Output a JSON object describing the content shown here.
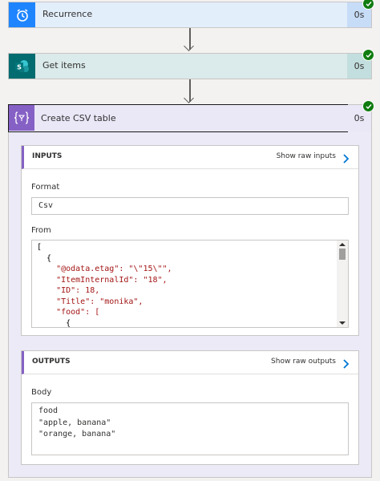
{
  "steps": {
    "recurrence": {
      "title": "Recurrence",
      "duration": "0s",
      "color": "#e3eefb",
      "icon_bg": "#1f85ff",
      "icon": "alarm-clock-icon"
    },
    "get_items": {
      "title": "Get items",
      "duration": "0s",
      "color": "#dbeaea",
      "icon_bg": "#036c70",
      "icon": "sharepoint-icon"
    },
    "create_csv": {
      "title": "Create CSV table",
      "duration": "0s",
      "icon_bg": "#8661c5",
      "icon": "data-operation-icon"
    }
  },
  "inputs": {
    "header": "INPUTS",
    "show_raw": "Show raw inputs",
    "format_label": "Format",
    "format_value": "Csv",
    "from_label": "From",
    "from_lines": [
      "[",
      "  {",
      "    \"@odata.etag\": \"\\\"15\\\"\",",
      "    \"ItemInternalId\": \"18\",",
      "    \"ID\": 18,",
      "    \"Title\": \"monika\",",
      "    \"food\": [",
      "      {"
    ]
  },
  "outputs": {
    "header": "OUTPUTS",
    "show_raw": "Show raw outputs",
    "body_label": "Body",
    "body_lines": [
      "food",
      "\"apple, banana\"",
      "\"orange, banana\""
    ]
  },
  "status_color": "#107c10"
}
